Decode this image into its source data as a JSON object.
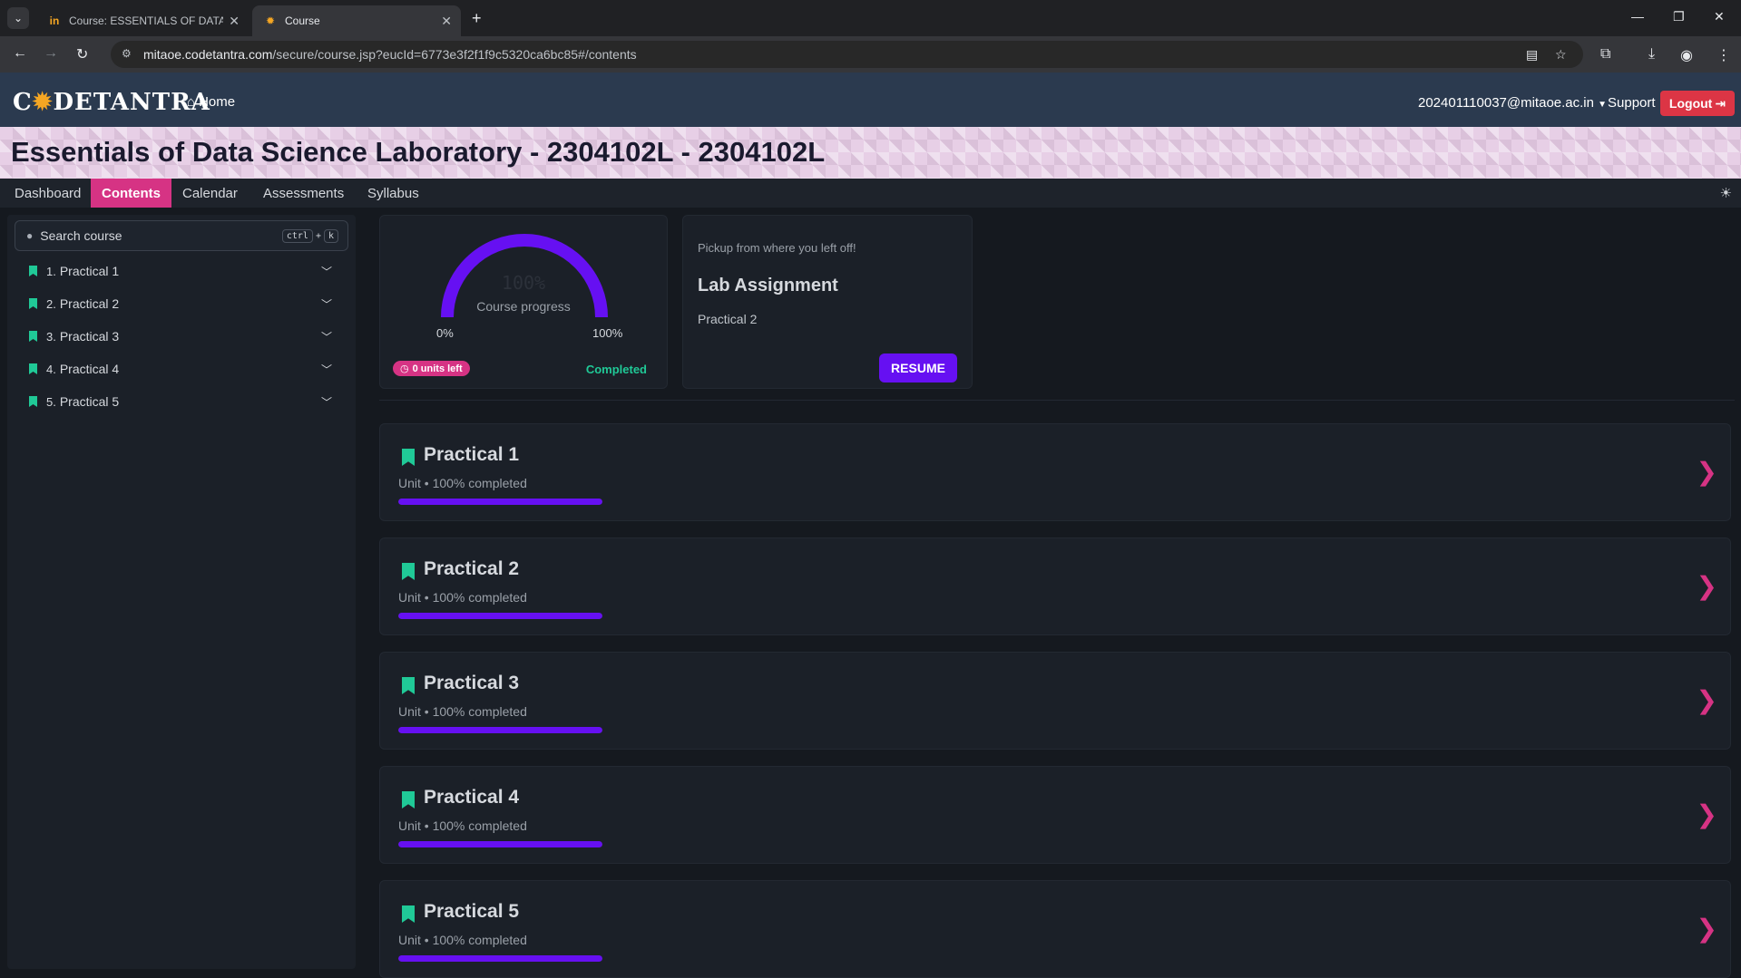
{
  "browser": {
    "tabs": [
      {
        "title": "Course: ESSENTIALS OF DATA S",
        "icon": "in-logo-icon"
      },
      {
        "title": "Course",
        "icon": "codetantra-favicon-icon"
      }
    ],
    "url_host": "mitaoe.codetantra.com",
    "url_path": "/secure/course.jsp?eucId=6773e3f2f1f9c5320ca6bc85#/contents"
  },
  "header": {
    "logo_pre": "C",
    "logo_o": "✹",
    "logo_post": "DETANTRA",
    "home": "Home",
    "user": "202401110037@mitaoe.ac.in",
    "support": "Support",
    "logout": "Logout"
  },
  "banner": {
    "title": "Essentials of Data Science Laboratory - 2304102L - 2304102L"
  },
  "tabs": [
    "Dashboard",
    "Contents",
    "Calendar",
    "Assessments",
    "Syllabus"
  ],
  "active_tab": "Contents",
  "sidebar": {
    "search_placeholder": "Search course",
    "shortcut": {
      "k1": "ctrl",
      "plus": "+",
      "k2": "k"
    },
    "items": [
      {
        "num": "1.",
        "label": "Practical 1"
      },
      {
        "num": "2.",
        "label": "Practical 2"
      },
      {
        "num": "3.",
        "label": "Practical 3"
      },
      {
        "num": "4.",
        "label": "Practical 4"
      },
      {
        "num": "5.",
        "label": "Practical 5"
      }
    ]
  },
  "progress": {
    "percent": "100%",
    "percent_value": 1.0,
    "label": "Course progress",
    "min": "0%",
    "max": "100%",
    "units_left": "0 units left",
    "status": "Completed",
    "accent": "#6610f2"
  },
  "resume": {
    "pickup": "Pickup from where you left off!",
    "title": "Lab Assignment",
    "subtitle": "Practical 2",
    "button": "RESUME"
  },
  "units": [
    {
      "title": "Practical 1",
      "subtitle": "Unit • 100% completed",
      "progress": 1.0
    },
    {
      "title": "Practical 2",
      "subtitle": "Unit • 100% completed",
      "progress": 1.0
    },
    {
      "title": "Practical 3",
      "subtitle": "Unit • 100% completed",
      "progress": 1.0
    },
    {
      "title": "Practical 4",
      "subtitle": "Unit • 100% completed",
      "progress": 1.0
    },
    {
      "title": "Practical 5",
      "subtitle": "Unit • 100% completed",
      "progress": 1.0
    }
  ],
  "colors": {
    "brand_pink": "#d63384",
    "success": "#20c997",
    "purple": "#6610f2",
    "danger": "#dc3545"
  }
}
